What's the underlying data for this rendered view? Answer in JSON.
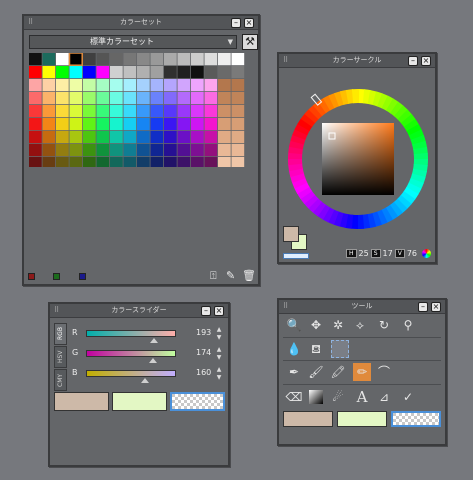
{
  "colors": {
    "bg": "#76787d",
    "main_swatch": "#cdb9a8",
    "sub_swatch": "#e3f7c4",
    "sel_tool": "#e08a3c"
  },
  "color_set": {
    "title": "カラーセット",
    "set_name": "標準カラーセット",
    "dropdown_icon": "chevron-down-icon",
    "settings_icon": "wrench-icon",
    "bottom_swatches": [
      "#8b1a1a",
      "#1c6b1c",
      "#1a1a8b"
    ],
    "row1": [
      "#111111",
      "#1c6b5d",
      "#ffffff",
      "#000000",
      "#404040",
      "#555555",
      "#666666",
      "#777777",
      "#888888",
      "#999999",
      "#aaaaaa",
      "#bbbbbb",
      "#cccccc",
      "#dddddd",
      "#eeeeee",
      "#ffffff"
    ],
    "row2": [
      "#ff0000",
      "#ffff00",
      "#00ff00",
      "#00ffff",
      "#0000ff",
      "#ff00ff",
      "#d0d0d0",
      "#c0c0c0",
      "#b0b0b0",
      "#a0a0a0",
      "#303030",
      "#202020",
      "#101010",
      "#5a5a5a",
      "#6a6a6a",
      "#7a7a7a"
    ]
  },
  "color_circle": {
    "title": "カラーサークル",
    "h_label": "H",
    "h_value": "25",
    "s_label": "S",
    "s_value": "17",
    "v_label": "V",
    "v_value": "76"
  },
  "color_slider": {
    "title": "カラースライダー",
    "tabs": [
      "RGB",
      "HSV",
      "CMY"
    ],
    "channels": [
      {
        "label": "R",
        "value": "193"
      },
      {
        "label": "G",
        "value": "174"
      },
      {
        "label": "B",
        "value": "160"
      }
    ]
  },
  "tools": {
    "title": "ツール",
    "row1": [
      "zoom-tool-icon",
      "move-tool-icon",
      "magic-wand-icon",
      "lasso-icon",
      "rotate-icon",
      "search-icon"
    ],
    "row2": [
      "eyedropper-icon",
      "bucket-icon",
      "selection-icon"
    ],
    "row3": [
      "pen-icon",
      "brush-icon",
      "airbrush-icon",
      "pencil-icon",
      "curve-icon"
    ],
    "row4": [
      "eraser-icon",
      "gradient-icon",
      "blend-icon",
      "text-icon",
      "ruler-icon",
      "balloon-icon"
    ],
    "text_tool_label": "A"
  }
}
